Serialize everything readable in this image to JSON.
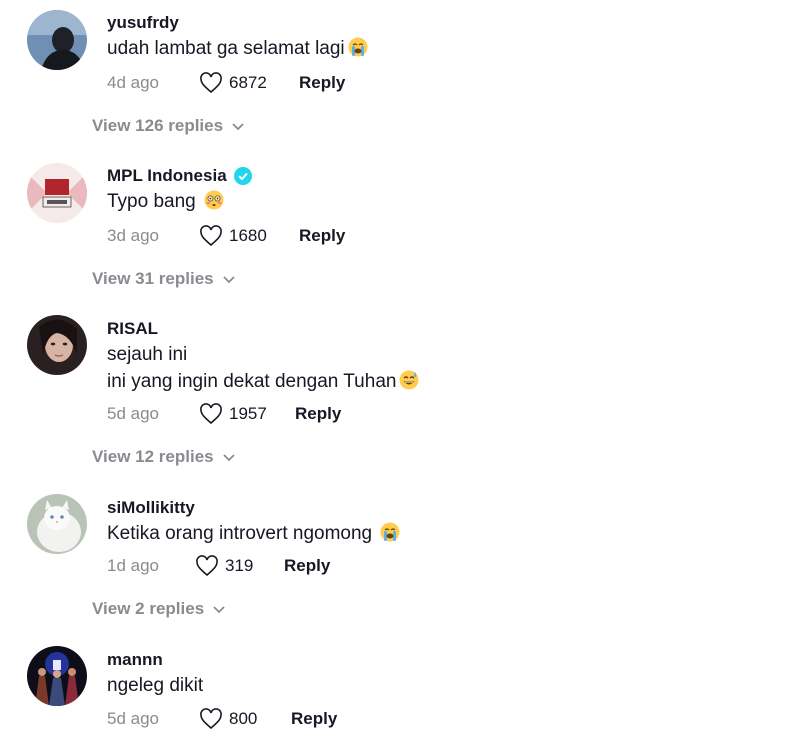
{
  "comments": [
    {
      "username": "yusufrdy",
      "verified": false,
      "lines": [
        "udah lambat ga selamat lagi"
      ],
      "emoji": "loudly-crying-face",
      "time": "4d ago",
      "likes": "6872",
      "reply_label": "Reply",
      "view_replies": "View 126 replies",
      "avatar_icon": "profile-photo-dark-silhouette"
    },
    {
      "username": "MPL Indonesia",
      "verified": true,
      "lines": [
        "Typo bang"
      ],
      "emoji": "flushed-face",
      "time": "3d ago",
      "likes": "1680",
      "reply_label": "Reply",
      "view_replies": "View 31 replies",
      "avatar_icon": "mpl-logo"
    },
    {
      "username": "RISAL",
      "verified": false,
      "lines": [
        "sejauh ini",
        "ini yang ingin dekat dengan Tuhan"
      ],
      "emoji": "grinning-sweat-face",
      "time": "5d ago",
      "likes": "1957",
      "reply_label": "Reply",
      "view_replies": "View 12 replies",
      "avatar_icon": "profile-photo-portrait"
    },
    {
      "username": "siMollikitty",
      "verified": false,
      "lines": [
        "Ketika orang introvert ngomong"
      ],
      "emoji": "loudly-crying-face",
      "time": "1d ago",
      "likes": "319",
      "reply_label": "Reply",
      "view_replies": "View 2 replies",
      "avatar_icon": "white-cat-photo"
    },
    {
      "username": "mannn",
      "verified": false,
      "lines": [
        "ngeleg dikit"
      ],
      "emoji": "",
      "time": "5d ago",
      "likes": "800",
      "reply_label": "Reply",
      "view_replies": "",
      "avatar_icon": "game-characters-photo"
    }
  ],
  "colors": {
    "text": "#161823",
    "muted": "#8a8b91",
    "verified": "#20d5ec"
  }
}
